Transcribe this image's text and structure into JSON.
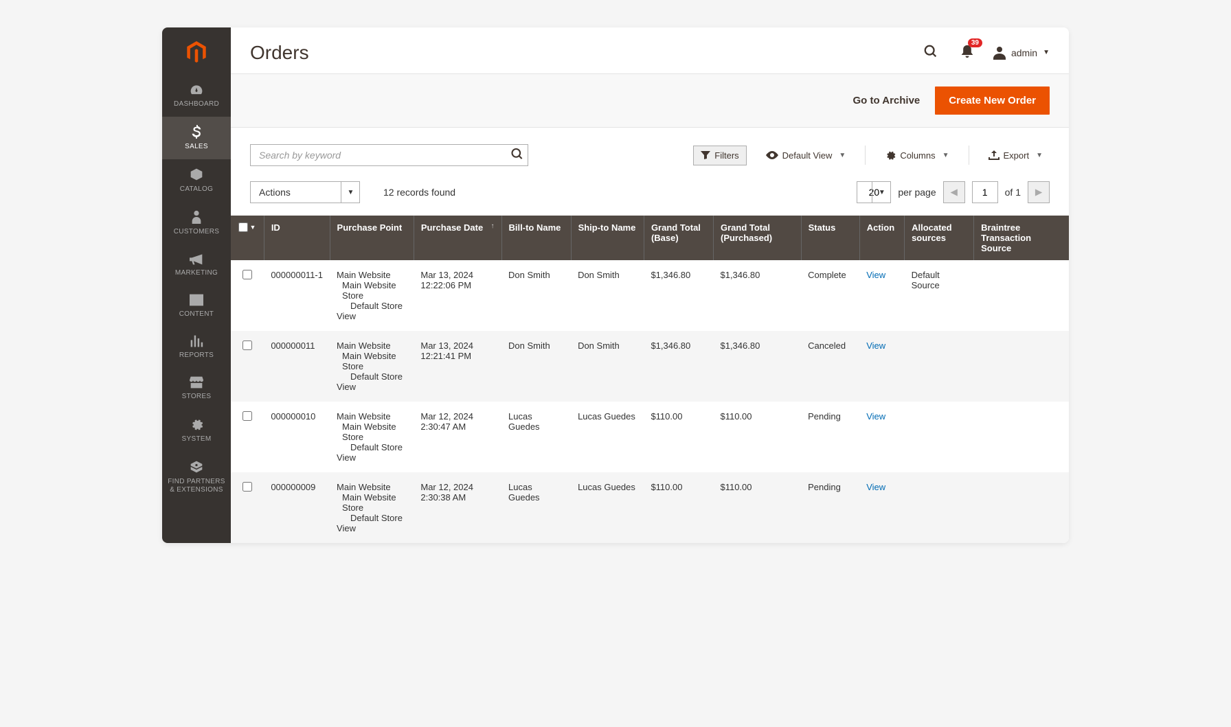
{
  "page": {
    "title": "Orders"
  },
  "header": {
    "notification_count": "39",
    "username": "admin"
  },
  "sidebar": {
    "items": [
      {
        "label": "DASHBOARD",
        "name": "sidebar-item-dashboard"
      },
      {
        "label": "SALES",
        "name": "sidebar-item-sales",
        "active": true
      },
      {
        "label": "CATALOG",
        "name": "sidebar-item-catalog"
      },
      {
        "label": "CUSTOMERS",
        "name": "sidebar-item-customers"
      },
      {
        "label": "MARKETING",
        "name": "sidebar-item-marketing"
      },
      {
        "label": "CONTENT",
        "name": "sidebar-item-content"
      },
      {
        "label": "REPORTS",
        "name": "sidebar-item-reports"
      },
      {
        "label": "STORES",
        "name": "sidebar-item-stores"
      },
      {
        "label": "SYSTEM",
        "name": "sidebar-item-system"
      },
      {
        "label": "FIND PARTNERS & EXTENSIONS",
        "name": "sidebar-item-partners"
      }
    ]
  },
  "actions_bar": {
    "archive_link": "Go to Archive",
    "create_order": "Create New Order"
  },
  "toolbar": {
    "search_placeholder": "Search by keyword",
    "filters": "Filters",
    "default_view": "Default View",
    "columns": "Columns",
    "export": "Export"
  },
  "toolbar2": {
    "actions": "Actions",
    "records_found": "12 records found",
    "per_page_value": "20",
    "per_page_label": "per page",
    "page_value": "1",
    "page_of": "of 1"
  },
  "grid": {
    "columns": {
      "id": "ID",
      "purchase_point": "Purchase Point",
      "purchase_date": "Purchase Date",
      "bill_to": "Bill-to Name",
      "ship_to": "Ship-to Name",
      "grand_total_base": "Grand Total (Base)",
      "grand_total_purchased": "Grand Total (Purchased)",
      "status": "Status",
      "action": "Action",
      "allocated_sources": "Allocated sources",
      "braintree": "Braintree Transaction Source"
    },
    "purchase_point_lines": {
      "l1": "Main Website",
      "l2": "Main Website",
      "l3": "Store",
      "l4": "Default Store",
      "l5": "View"
    },
    "action_label": "View",
    "rows": [
      {
        "id": "000000011-1",
        "date_l1": "Mar 13, 2024",
        "date_l2": "12:22:06 PM",
        "bill_to": "Don Smith",
        "ship_to": "Don Smith",
        "gtb": "$1,346.80",
        "gtp": "$1,346.80",
        "status": "Complete",
        "allocated": "Default Source",
        "braintree": ""
      },
      {
        "id": "000000011",
        "date_l1": "Mar 13, 2024",
        "date_l2": "12:21:41 PM",
        "bill_to": "Don Smith",
        "ship_to": "Don Smith",
        "gtb": "$1,346.80",
        "gtp": "$1,346.80",
        "status": "Canceled",
        "allocated": "",
        "braintree": ""
      },
      {
        "id": "000000010",
        "date_l1": "Mar 12, 2024",
        "date_l2": "2:30:47 AM",
        "bill_to": "Lucas Guedes",
        "ship_to": "Lucas Guedes",
        "gtb": "$110.00",
        "gtp": "$110.00",
        "status": "Pending",
        "allocated": "",
        "braintree": ""
      },
      {
        "id": "000000009",
        "date_l1": "Mar 12, 2024",
        "date_l2": "2:30:38 AM",
        "bill_to": "Lucas Guedes",
        "ship_to": "Lucas Guedes",
        "gtb": "$110.00",
        "gtp": "$110.00",
        "status": "Pending",
        "allocated": "",
        "braintree": ""
      }
    ]
  }
}
